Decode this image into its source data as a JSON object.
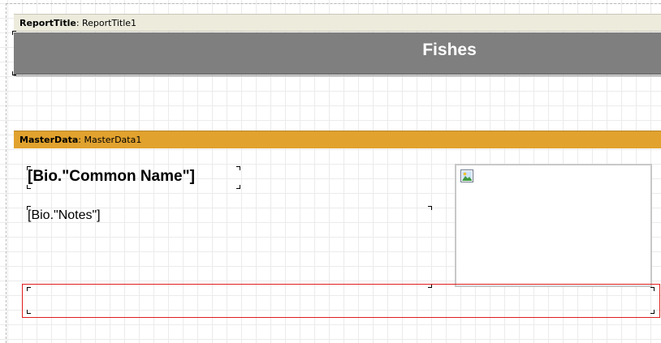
{
  "report_title_band": {
    "type_label": "ReportTitle",
    "separator": ": ",
    "name": "ReportTitle1",
    "title_text": "Fishes",
    "header_color": "#ecebdc",
    "title_bg_color": "#7f7f7f"
  },
  "master_data_band": {
    "type_label": "MasterData",
    "separator": ": ",
    "name": "MasterData1",
    "header_color": "#e1a22e"
  },
  "fields": {
    "common_name": "[Bio.\"Common Name\"]",
    "notes": "[Bio.\"Notes\"]"
  },
  "picture": {
    "icon": "picture-placeholder-icon"
  },
  "selection": {
    "color": "#e11c1c"
  }
}
